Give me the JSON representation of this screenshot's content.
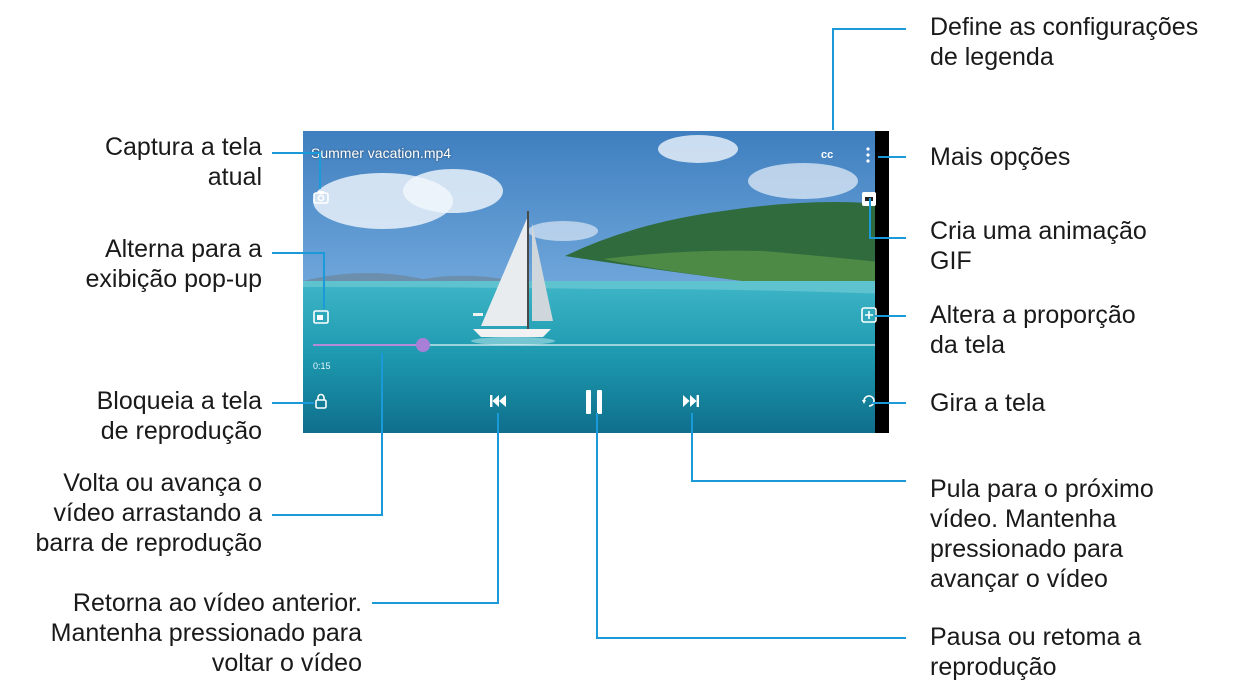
{
  "video": {
    "filename": "Summer vacation.mp4",
    "current_time": "0:15",
    "progress": 0.195
  },
  "icons": {
    "subtitles": "cc-icon",
    "more": "more-vert-icon",
    "capture": "camera-icon",
    "popup": "popup-icon",
    "gif": "gif-icon",
    "ratio": "aspect-ratio-icon",
    "lock": "lock-icon",
    "rotate": "rotate-icon",
    "previous": "previous-icon",
    "pause": "pause-icon",
    "next": "next-icon"
  },
  "callouts": {
    "subtitles": "Define as configurações\nde legenda",
    "capture": "Captura a tela\natual",
    "more": "Mais opções",
    "gif": "Cria uma animação\nGIF",
    "popup": "Alterna para a\nexibição pop-up",
    "ratio": "Altera a proporção\nda tela",
    "lock": "Bloqueia a tela\nde reprodução",
    "rotate": "Gira a tela",
    "seek": "Volta ou avança o\nvídeo arrastando a\nbarra de reprodução",
    "next": "Pula para o próximo\nvídeo. Mantenha\npressionado para\navançar o vídeo",
    "previous": "Retorna ao vídeo anterior.\nMantenha pressionado para\nvoltar o vídeo",
    "pause": "Pausa ou retoma a\nreprodução"
  },
  "colors": {
    "accent_line": "#1a9ad8",
    "progress": "#a77fd6"
  }
}
